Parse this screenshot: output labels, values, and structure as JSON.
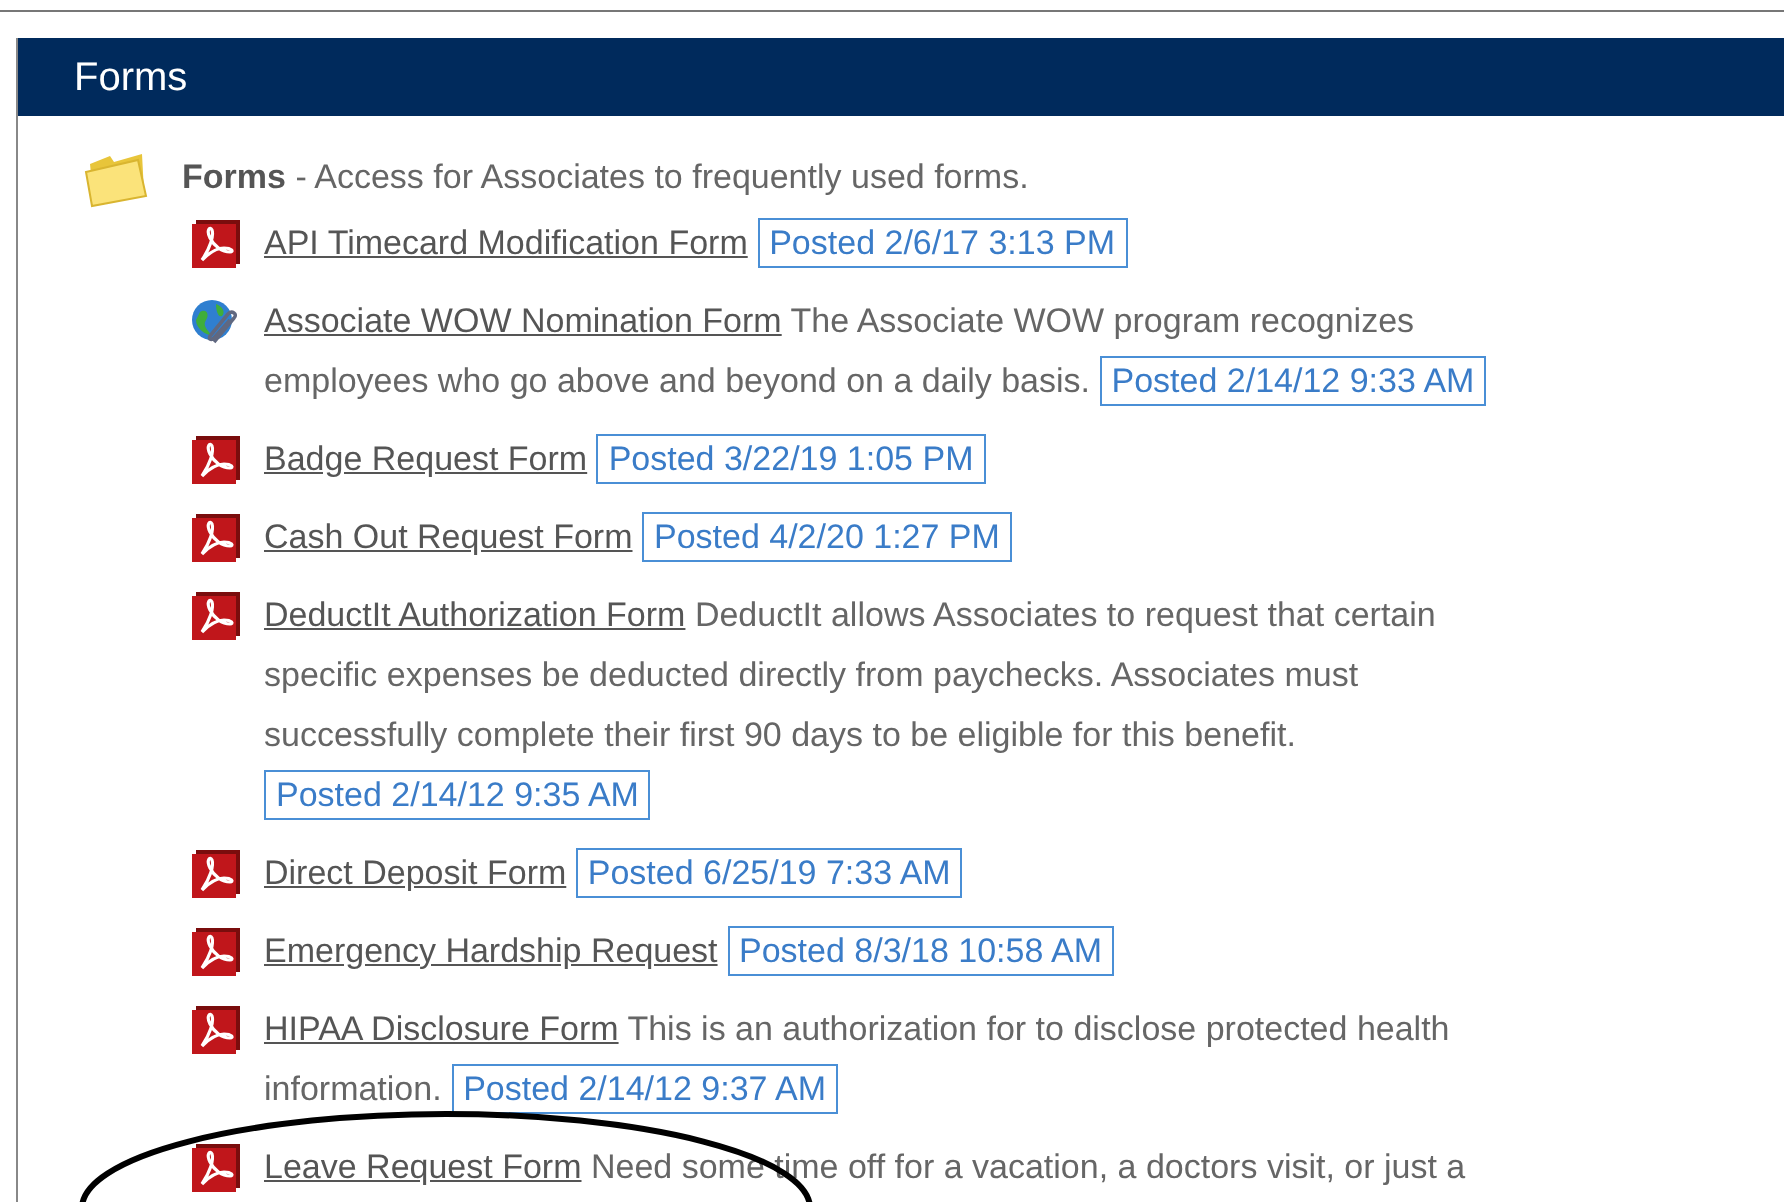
{
  "panel": {
    "title": "Forms"
  },
  "folder": {
    "name": "Forms",
    "description": " - Access for Associates to frequently used forms."
  },
  "items": [
    {
      "kind": "pdf",
      "title": "API Timecard Modification Form",
      "posted": "Posted 2/6/17 3:13 PM"
    },
    {
      "kind": "link",
      "title": "Associate WOW Nomination Form",
      "description": "The Associate WOW program recognizes employees who go above and beyond on a daily basis.",
      "posted": "Posted 2/14/12 9:33 AM"
    },
    {
      "kind": "pdf",
      "title": "Badge Request Form",
      "posted": "Posted 3/22/19 1:05 PM"
    },
    {
      "kind": "pdf",
      "title": "Cash Out Request Form",
      "posted": "Posted 4/2/20 1:27 PM"
    },
    {
      "kind": "pdf",
      "title": "DeductIt Authorization Form",
      "description": "DeductIt allows Associates to request that certain specific expenses be deducted directly from paychecks. Associates must successfully complete their first 90 days to be eligible for this benefit.",
      "posted": "Posted 2/14/12 9:35 AM"
    },
    {
      "kind": "pdf",
      "title": "Direct Deposit Form",
      "posted": "Posted 6/25/19 7:33 AM"
    },
    {
      "kind": "pdf",
      "title": "Emergency Hardship Request",
      "posted": "Posted 8/3/18 10:58 AM"
    },
    {
      "kind": "pdf",
      "title": "HIPAA Disclosure Form",
      "description": "This is an authorization for to disclose protected health information.",
      "posted": "Posted 2/14/12 9:37 AM"
    },
    {
      "kind": "pdf",
      "title": "Leave Request Form",
      "description": "Need some time off for a vacation, a doctors visit, or just a"
    }
  ]
}
